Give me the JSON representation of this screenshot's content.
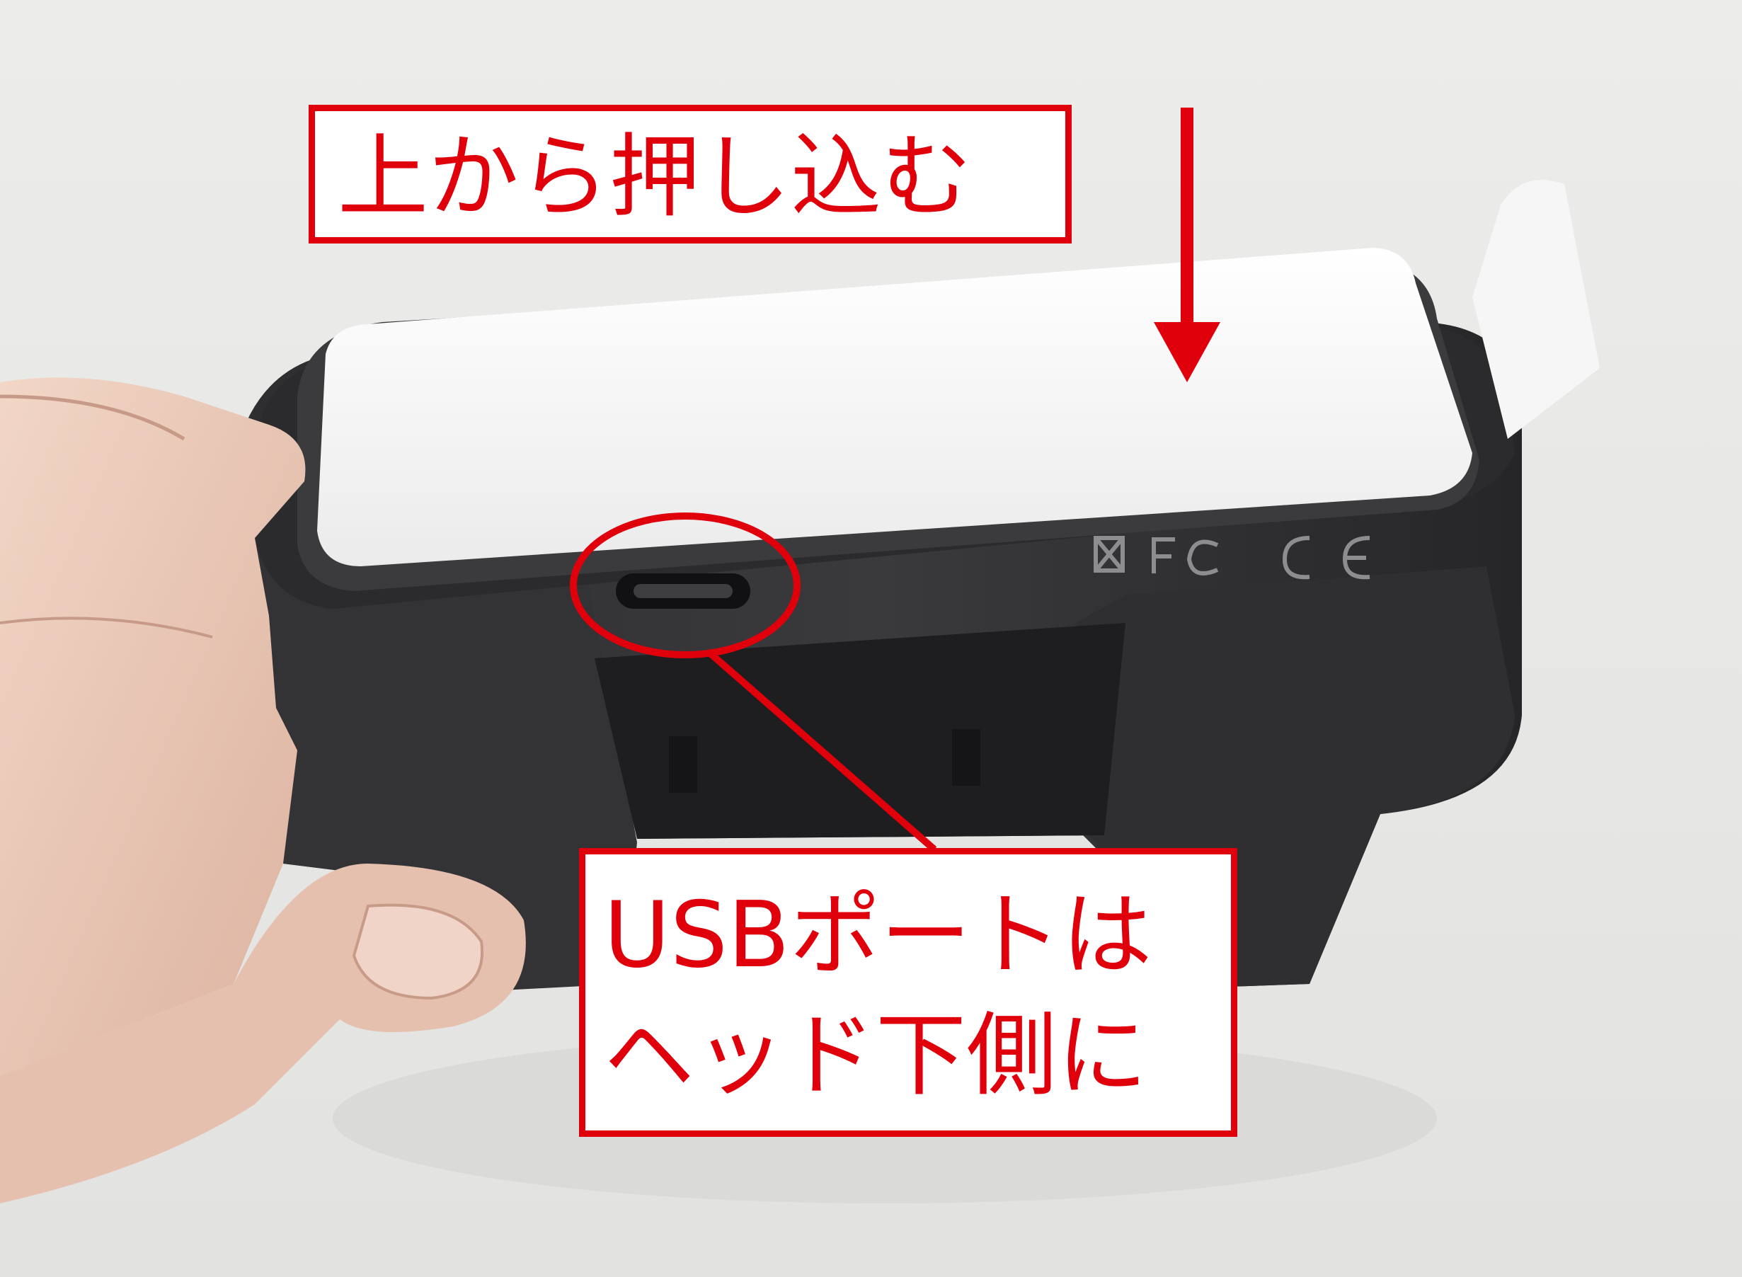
{
  "annotations": {
    "top_label": "上から押し込む",
    "bottom_label_line1": "USBポートは",
    "bottom_label_line2": "ヘッド下側に"
  },
  "product_markings": {
    "logos": [
      "weee-bin-icon",
      "fcc-logo",
      "ce-mark"
    ]
  },
  "colors": {
    "annotation_red": "#e0000c",
    "background": "#e9e9e7",
    "device_white": "#f4f4f4",
    "holder_black": "#2a2a2c"
  }
}
